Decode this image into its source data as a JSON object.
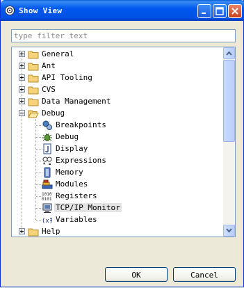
{
  "window": {
    "title": "Show View"
  },
  "filter": {
    "placeholder": "type filter text",
    "value": ""
  },
  "tree": {
    "items": [
      {
        "label": "General",
        "icon": "folder-icon",
        "expander": "plus"
      },
      {
        "label": "Ant",
        "icon": "folder-icon",
        "expander": "plus"
      },
      {
        "label": "API Tooling",
        "icon": "folder-icon",
        "expander": "plus"
      },
      {
        "label": "CVS",
        "icon": "folder-icon",
        "expander": "plus"
      },
      {
        "label": "Data Management",
        "icon": "folder-icon",
        "expander": "plus"
      },
      {
        "label": "Debug",
        "icon": "open-folder-icon",
        "expander": "minus"
      },
      {
        "label": "Breakpoints",
        "icon": "breakpoints-icon"
      },
      {
        "label": "Debug",
        "icon": "debug-bug-icon"
      },
      {
        "label": "Display",
        "icon": "display-icon"
      },
      {
        "label": "Expressions",
        "icon": "expressions-icon"
      },
      {
        "label": "Memory",
        "icon": "memory-icon"
      },
      {
        "label": "Modules",
        "icon": "modules-icon"
      },
      {
        "label": "Registers",
        "icon": "registers-icon"
      },
      {
        "label": "TCP/IP Monitor",
        "icon": "monitor-icon",
        "selected": true
      },
      {
        "label": "Variables",
        "icon": "variables-icon"
      },
      {
        "label": "Help",
        "icon": "folder-icon",
        "expander": "plus"
      }
    ]
  },
  "buttons": {
    "ok": "OK",
    "cancel": "Cancel"
  }
}
